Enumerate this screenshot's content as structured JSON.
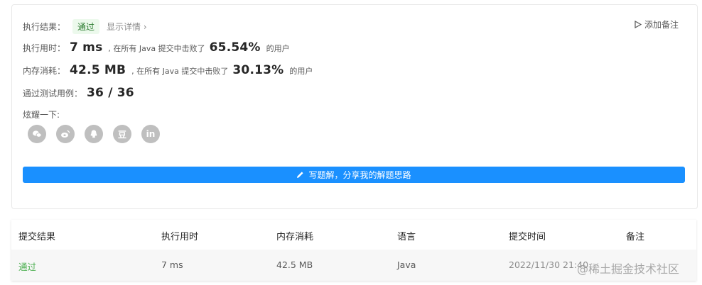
{
  "result": {
    "label": "执行结果：",
    "status": "通过",
    "detail_link": "显示详情 ›",
    "add_note": "添加备注"
  },
  "runtime": {
    "label": "执行用时：",
    "value": "7 ms",
    "prefix": ", 在所有 Java 提交中击败了",
    "percent": "65.54%",
    "suffix": "的用户"
  },
  "memory": {
    "label": "内存消耗：",
    "value": "42.5 MB",
    "prefix": ", 在所有 Java 提交中击败了",
    "percent": "30.13%",
    "suffix": "的用户"
  },
  "tests": {
    "label": "通过测试用例：",
    "value": "36 / 36"
  },
  "share": {
    "label": "炫耀一下:",
    "icons": [
      "wechat-icon",
      "weibo-icon",
      "qq-icon",
      "douban-icon",
      "linkedin-icon"
    ],
    "douban_glyph": "豆",
    "linkedin_glyph": "in"
  },
  "write_solution": "写题解，分享我的解题思路",
  "table": {
    "headers": [
      "提交结果",
      "执行用时",
      "内存消耗",
      "语言",
      "提交时间",
      "备注"
    ],
    "row": [
      "通过",
      "7 ms",
      "42.5 MB",
      "Java",
      "2022/11/30 21:40"
    ]
  },
  "watermark": "@稀土掘金技术社区",
  "colors": {
    "accent": "#1a90ff",
    "success": "#4caf50",
    "badge_bg": "#ecf9ec",
    "icon_bg": "#bfbfbf"
  }
}
